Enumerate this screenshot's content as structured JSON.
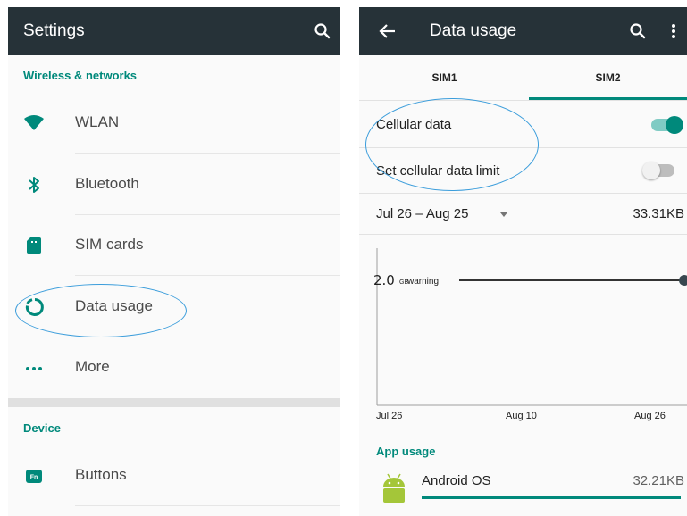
{
  "settings": {
    "title": "Settings",
    "section_wireless": "Wireless & networks",
    "section_device": "Device",
    "items": [
      {
        "label": "WLAN",
        "icon": "wifi-icon"
      },
      {
        "label": "Bluetooth",
        "icon": "bluetooth-icon"
      },
      {
        "label": "SIM cards",
        "icon": "sim-card-icon"
      },
      {
        "label": "Data usage",
        "icon": "data-usage-icon"
      },
      {
        "label": "More",
        "icon": "more-horiz-icon"
      }
    ],
    "device_items": [
      {
        "label": "Buttons",
        "icon": "fn-buttons-icon"
      }
    ]
  },
  "data_usage": {
    "title": "Data usage",
    "tabs": [
      "SIM1",
      "SIM2"
    ],
    "selected_tab": "SIM2",
    "cellular_data_label": "Cellular data",
    "cellular_data_on": true,
    "limit_label": "Set cellular data limit",
    "limit_on": false,
    "cycle_label": "Jul 26 – Aug 25",
    "cycle_total": "33.31KB",
    "warning_value": "2.0",
    "warning_unit": "GB",
    "warning_text": "warning",
    "x_labels": [
      "Jul 26",
      "Aug 10",
      "Aug 26"
    ],
    "app_usage_heading": "App usage",
    "apps": [
      {
        "name": "Android OS",
        "usage": "32.21KB",
        "usage_fraction": 1.0
      }
    ]
  },
  "colors": {
    "toolbar": "#263238",
    "accent": "#00897b",
    "callout": "#3b9ddb",
    "android_green": "#a4c639"
  }
}
